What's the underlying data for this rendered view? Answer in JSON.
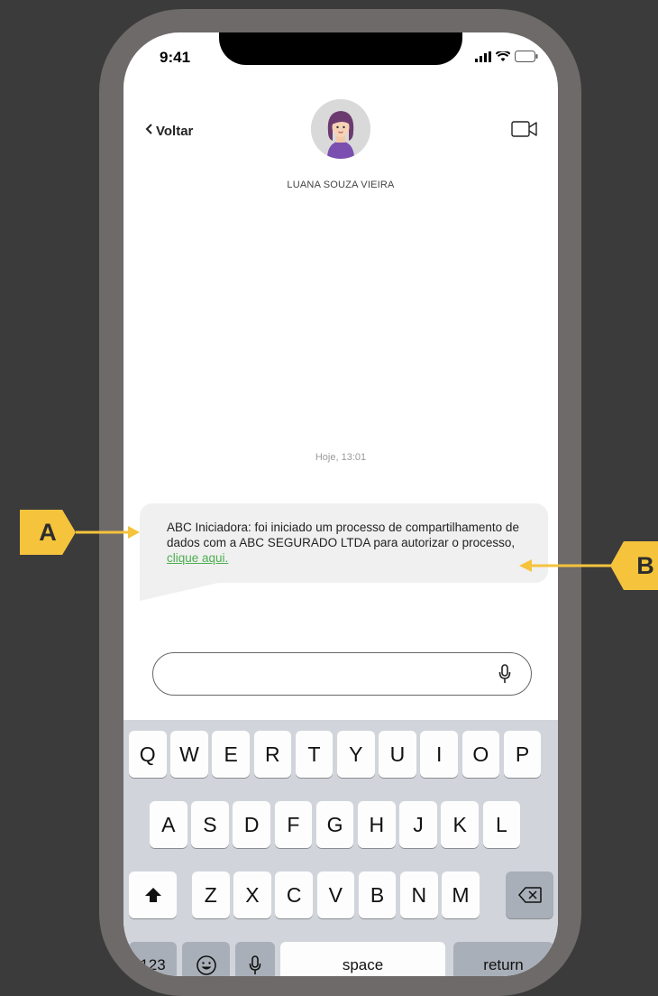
{
  "status_bar": {
    "time": "9:41"
  },
  "header": {
    "back_label": "Voltar",
    "contact_name": "LUANA SOUZA VIEIRA"
  },
  "conversation": {
    "timestamp": "Hoje, 13:01",
    "message_text": "ABC Iniciadora: foi iniciado um processo de compartilhamento de dados com a ABC SEGURADO LTDA para autorizar o processo, ",
    "message_link": "clique aqui."
  },
  "compose": {
    "placeholder": ""
  },
  "keyboard": {
    "row1": [
      "Q",
      "W",
      "E",
      "R",
      "T",
      "Y",
      "U",
      "I",
      "O",
      "P"
    ],
    "row2": [
      "A",
      "S",
      "D",
      "F",
      "G",
      "H",
      "J",
      "K",
      "L"
    ],
    "row3": [
      "Z",
      "X",
      "C",
      "V",
      "B",
      "N",
      "M"
    ],
    "numbers_label": "123",
    "space_label": "space",
    "return_label": "return"
  },
  "annotations": {
    "a_label": "A",
    "b_label": "B"
  },
  "colors": {
    "background": "#3b3b3b",
    "frame": "#6e6a69",
    "callout": "#f5c33c",
    "link": "#4caf50",
    "keyboard": "#d1d5db"
  }
}
